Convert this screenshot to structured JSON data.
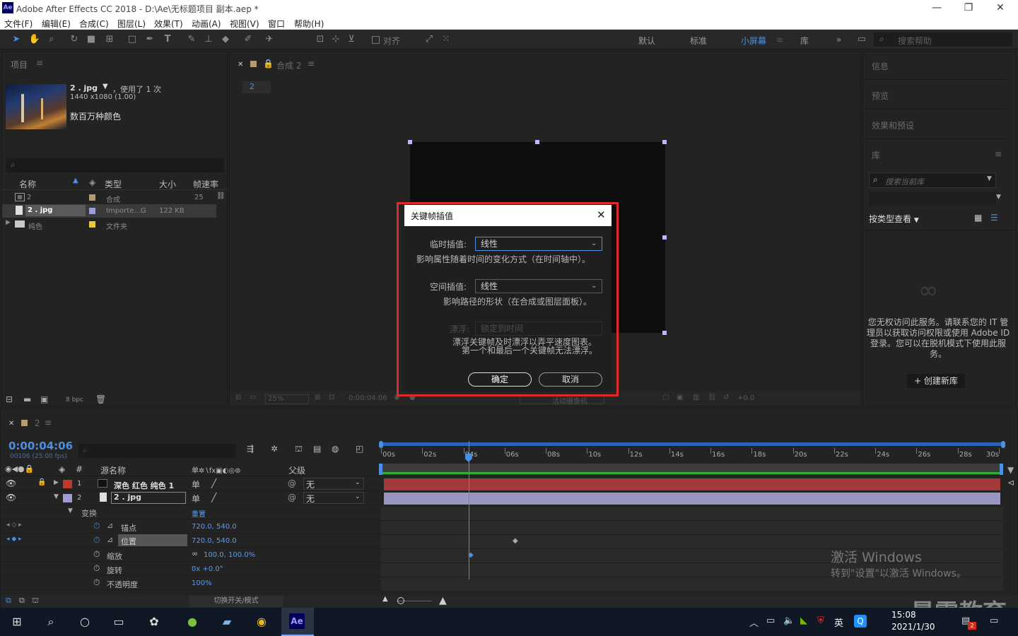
{
  "window": {
    "title": "Adobe After Effects CC 2018 - D:\\Ae\\无标题项目 副本.aep *",
    "logo": "Ae",
    "minimize": "—",
    "restore": "❐",
    "close": "✕"
  },
  "menu": [
    "文件(F)",
    "编辑(E)",
    "合成(C)",
    "图层(L)",
    "效果(T)",
    "动画(A)",
    "视图(V)",
    "窗口",
    "帮助(H)"
  ],
  "toolbar": {
    "align_label": "对齐",
    "workspaces": [
      "默认",
      "标准",
      "小屏幕",
      "库"
    ],
    "active_workspace": "小屏幕",
    "more": "»",
    "search_placeholder": "搜索帮助"
  },
  "project": {
    "title": "项目",
    "file_name": "2 . jpg",
    "used": "，使用了 1 次",
    "dimensions": "1440 x1080 (1.00)",
    "colors": "数百万种颜色",
    "columns": [
      "名称",
      "类型",
      "大小",
      "帧速率"
    ],
    "items": [
      {
        "name": "2",
        "type": "合成",
        "size": "",
        "fps": "25",
        "color": "#b49a73"
      },
      {
        "name": "2 . jpg",
        "type": "Importe...G",
        "size": "122 KB",
        "fps": "",
        "color": "#9d9dd6"
      },
      {
        "name": "纯色",
        "type": "文件夹",
        "size": "",
        "fps": "",
        "color": "#e8c83a"
      }
    ],
    "bpc": "8 bpc"
  },
  "composition": {
    "tab": "合成 2",
    "breadcrumb": "2",
    "zoom": "25%",
    "timecode": "0:00:04:06",
    "exposure": "+0.0",
    "footer_hint": "活动摄像机"
  },
  "dialog": {
    "title": "关键帧插值",
    "temporal_label": "临时插值:",
    "temporal_value": "线性",
    "temporal_desc": "影响属性随着时间的变化方式（在时间轴中）。",
    "spatial_label": "空间插值:",
    "spatial_value": "线性",
    "spatial_desc": "影响路径的形状（在合成或图层面板）。",
    "roving_label": "漂浮:",
    "roving_value": "锁定到时间",
    "roving_desc_1": "漂浮关键帧及时漂浮以弄平速度图表。",
    "roving_desc_2": "第一个和最后一个关键帧无法漂浮。",
    "ok": "确定",
    "cancel": "取消"
  },
  "right_panel": {
    "info": "信息",
    "preview": "预览",
    "effects": "效果和预设",
    "library": "库",
    "search_placeholder": "搜索当前库",
    "view_by": "按类型查看",
    "notice": "您无权访问此服务。请联系您的 IT 管理员以获取访问权限或使用 Adobe ID 登录。您可以在脱机模式下使用此服务。",
    "create_button": "+ 创建新库"
  },
  "timeline": {
    "tab": "2",
    "timecode": "0:00:04:06",
    "fps": "00106 (25.00 fps)",
    "col_source": "源名称",
    "col_parent": "父级",
    "ruler": [
      "00s",
      "02s",
      "04s",
      "06s",
      "08s",
      "10s",
      "12s",
      "14s",
      "16s",
      "18s",
      "20s",
      "22s",
      "24s",
      "26s",
      "28s",
      "30s"
    ],
    "playhead_sec": 4.25,
    "duration_sec": 30,
    "layers": [
      {
        "num": "1",
        "name": "深色 红色 纯色 1",
        "parent": "无",
        "color": "#c0392b",
        "bar": "#a23a3a"
      },
      {
        "num": "2",
        "name": "2 . jpg",
        "parent": "无",
        "color": "#9d9dd6",
        "bar": "#9a96c4"
      }
    ],
    "transform": "变换",
    "reset": "重置",
    "props": [
      {
        "name": "锚点",
        "value": "720.0, 540.0"
      },
      {
        "name": "位置",
        "value": "720.0, 540.0"
      },
      {
        "name": "缩放",
        "value": "100.0, 100.0%"
      },
      {
        "name": "旋转",
        "value": "0x +0.0°"
      },
      {
        "name": "不透明度",
        "value": "100%"
      }
    ],
    "toggle_modes": "切换开关/模式"
  },
  "watermark": {
    "line1": "激活 Windows",
    "line2": "转到\"设置\"以激活 Windows。",
    "brand": "曼需教育"
  },
  "taskbar": {
    "time": "15:08",
    "date": "2021/1/30",
    "ime": "英",
    "notify_count": "2",
    "ae": "Ae"
  }
}
